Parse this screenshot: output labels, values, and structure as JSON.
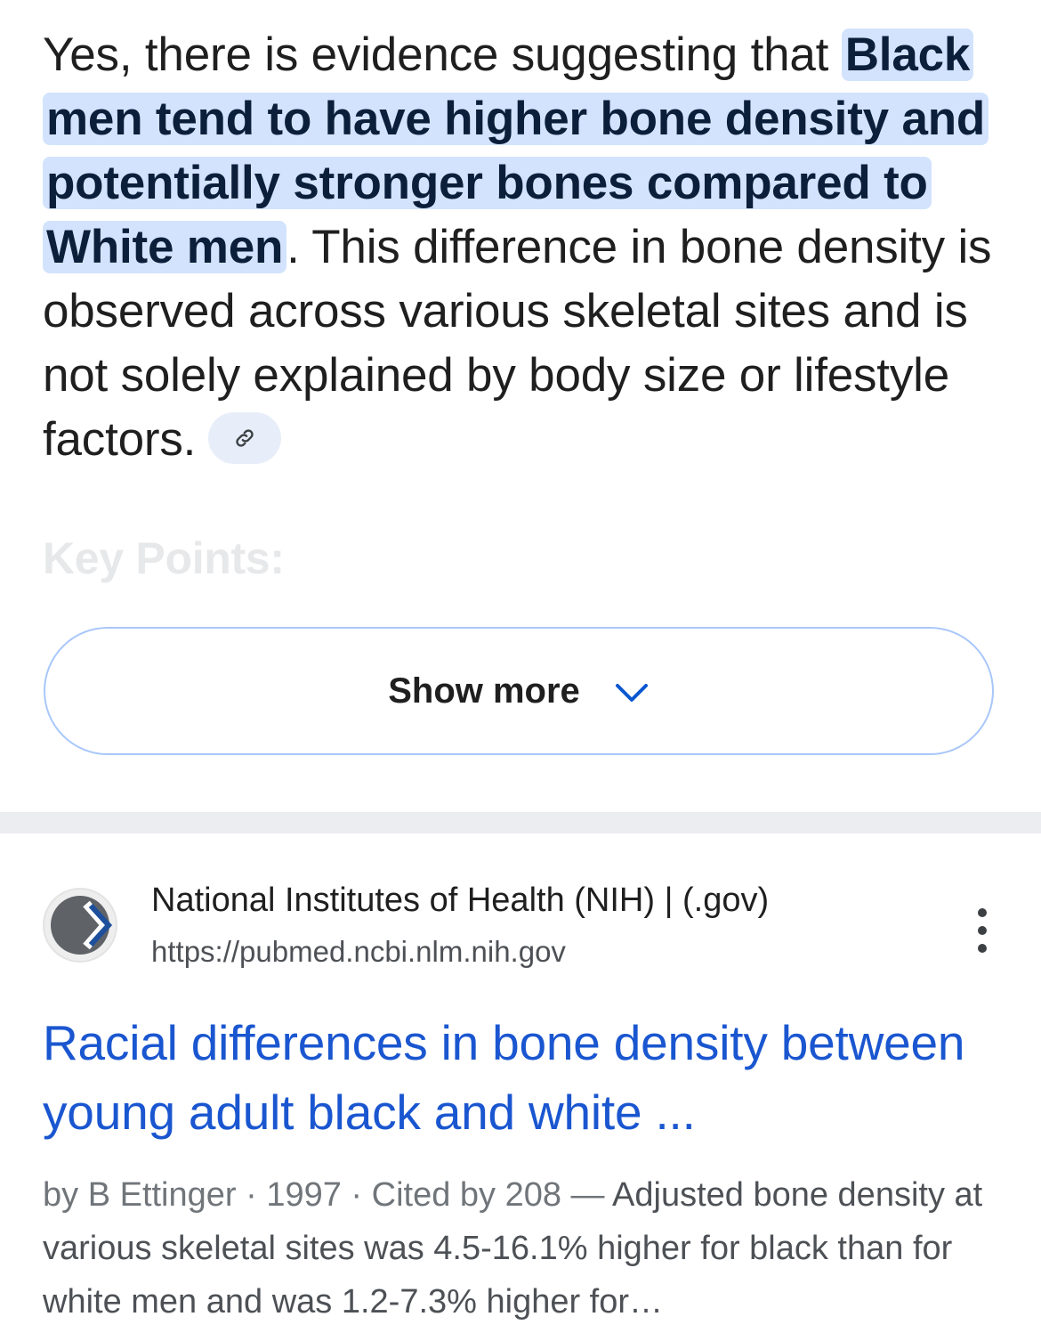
{
  "answer": {
    "intro": "Yes, there is evidence suggesting that ",
    "highlight": "Black men tend to have higher bone density and potentially stronger bones compared to White men",
    "rest": ". This difference in bone density is observed across various skeletal sites and is not solely explained by body size or lifestyle factors.",
    "link_icon": "link-icon"
  },
  "key_points_heading": "Key Points:",
  "show_more": {
    "label": "Show more",
    "icon": "chevron-down-icon"
  },
  "result": {
    "favicon": "nih-logo",
    "site_name": "National Institutes of Health (NIH) | (.gov)",
    "url": "https://pubmed.ncbi.nlm.nih.gov",
    "menu_icon": "more-vert-icon",
    "title": "Racial differences in bone density between young adult black and white ...",
    "snippet_meta": "by B Ettinger · 1997 · Cited by 208 — ",
    "snippet_text": "Adjusted bone density at various skeletal sites was 4.5-16.1% higher for black than for white men and was 1.2-7.3% higher for…"
  },
  "colors": {
    "highlight_bg": "#d3e3fd",
    "link_blue": "#1a56d0",
    "button_border": "#a8c7fa",
    "chevron_blue": "#0b57d0"
  }
}
